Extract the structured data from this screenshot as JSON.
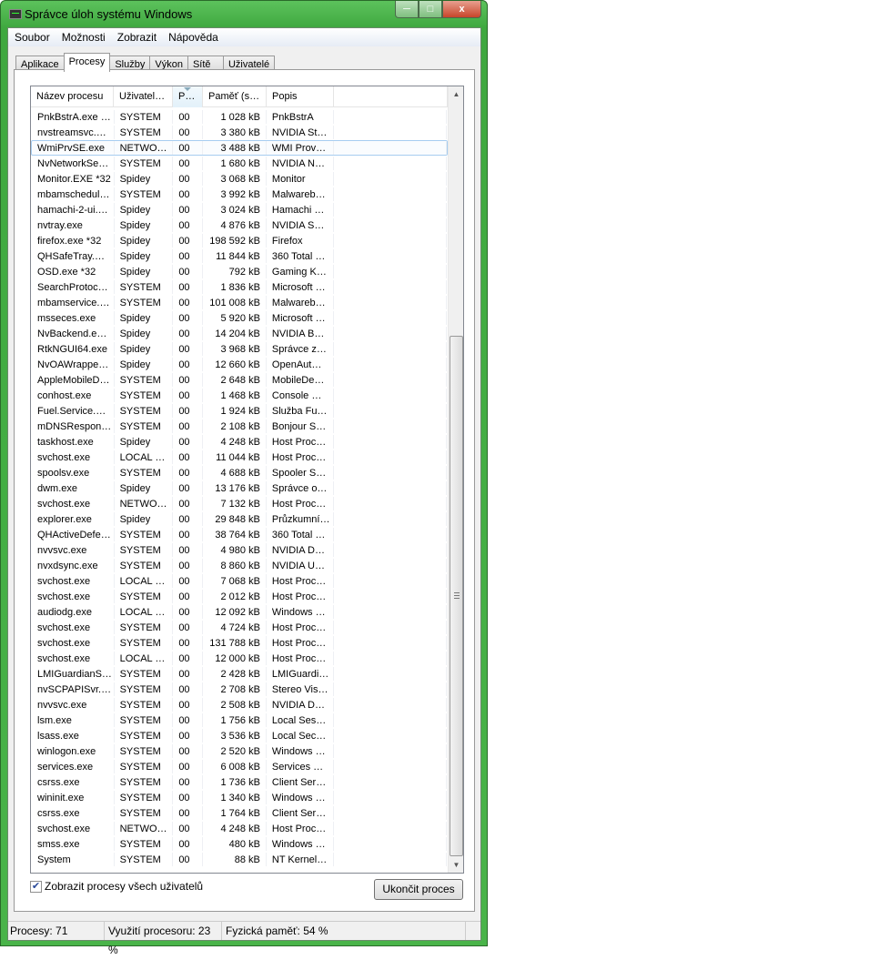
{
  "window": {
    "title": "Správce úloh systému Windows",
    "minimize": "─",
    "maximize": "□",
    "close": "x"
  },
  "menu": [
    {
      "label": "Soubor"
    },
    {
      "label": "Možnosti"
    },
    {
      "label": "Zobrazit"
    },
    {
      "label": "Nápověda"
    }
  ],
  "tabs": [
    {
      "label": "Aplikace"
    },
    {
      "label": "Procesy",
      "active": true
    },
    {
      "label": "Služby"
    },
    {
      "label": "Výkon"
    },
    {
      "label": "Sítě"
    },
    {
      "label": "Uživatelé"
    }
  ],
  "columns": [
    "Název procesu",
    "Uživatel…",
    "P…",
    "Paměť (s…",
    "Popis",
    ""
  ],
  "sorted_column": "P…",
  "selected_row": "WmiPrvSE.exe",
  "rows": [
    [
      "PnkBstrA.exe …",
      "SYSTEM",
      "00",
      "1 028 kB",
      "PnkBstrA"
    ],
    [
      "nvstreamsvc.…",
      "SYSTEM",
      "00",
      "3 380 kB",
      "NVIDIA St…"
    ],
    [
      "WmiPrvSE.exe",
      "NETWO…",
      "00",
      "3 488 kB",
      "WMI Prov…"
    ],
    [
      "NvNetworkSe…",
      "SYSTEM",
      "00",
      "1 680 kB",
      "NVIDIA N…"
    ],
    [
      "Monitor.EXE *32",
      "Spidey",
      "00",
      "3 068 kB",
      "Monitor"
    ],
    [
      "mbamschedul…",
      "SYSTEM",
      "00",
      "3 992 kB",
      "Malwareb…"
    ],
    [
      "hamachi-2-ui.…",
      "Spidey",
      "00",
      "3 024 kB",
      "Hamachi …"
    ],
    [
      "nvtray.exe",
      "Spidey",
      "00",
      "4 876 kB",
      "NVIDIA S…"
    ],
    [
      "firefox.exe *32",
      "Spidey",
      "00",
      "198 592 kB",
      "Firefox"
    ],
    [
      "QHSafeTray.…",
      "Spidey",
      "00",
      "11 844 kB",
      "360 Total …"
    ],
    [
      "OSD.exe *32",
      "Spidey",
      "00",
      "792 kB",
      "Gaming K…"
    ],
    [
      "SearchProtoc…",
      "SYSTEM",
      "00",
      "1 836 kB",
      "Microsoft …"
    ],
    [
      "mbamservice.…",
      "SYSTEM",
      "00",
      "101 008 kB",
      "Malwareb…"
    ],
    [
      "msseces.exe",
      "Spidey",
      "00",
      "5 920 kB",
      "Microsoft …"
    ],
    [
      "NvBackend.e…",
      "Spidey",
      "00",
      "14 204 kB",
      "NVIDIA B…"
    ],
    [
      "RtkNGUI64.exe",
      "Spidey",
      "00",
      "3 968 kB",
      "Správce z…"
    ],
    [
      "NvOAWrappe…",
      "Spidey",
      "00",
      "12 660 kB",
      "OpenAut…"
    ],
    [
      "AppleMobileD…",
      "SYSTEM",
      "00",
      "2 648 kB",
      "MobileDe…"
    ],
    [
      "conhost.exe",
      "SYSTEM",
      "00",
      "1 468 kB",
      "Console …"
    ],
    [
      "Fuel.Service.…",
      "SYSTEM",
      "00",
      "1 924 kB",
      "Služba Fu…"
    ],
    [
      "mDNSRespon…",
      "SYSTEM",
      "00",
      "2 108 kB",
      "Bonjour S…"
    ],
    [
      "taskhost.exe",
      "Spidey",
      "00",
      "4 248 kB",
      "Host Proc…"
    ],
    [
      "svchost.exe",
      "LOCAL …",
      "00",
      "11 044 kB",
      "Host Proc…"
    ],
    [
      "spoolsv.exe",
      "SYSTEM",
      "00",
      "4 688 kB",
      "Spooler S…"
    ],
    [
      "dwm.exe",
      "Spidey",
      "00",
      "13 176 kB",
      "Správce o…"
    ],
    [
      "svchost.exe",
      "NETWO…",
      "00",
      "7 132 kB",
      "Host Proc…"
    ],
    [
      "explorer.exe",
      "Spidey",
      "00",
      "29 848 kB",
      "Průzkumní…"
    ],
    [
      "QHActiveDefe…",
      "SYSTEM",
      "00",
      "38 764 kB",
      "360 Total …"
    ],
    [
      "nvvsvc.exe",
      "SYSTEM",
      "00",
      "4 980 kB",
      "NVIDIA D…"
    ],
    [
      "nvxdsync.exe",
      "SYSTEM",
      "00",
      "8 860 kB",
      "NVIDIA U…"
    ],
    [
      "svchost.exe",
      "LOCAL …",
      "00",
      "7 068 kB",
      "Host Proc…"
    ],
    [
      "svchost.exe",
      "SYSTEM",
      "00",
      "2 012 kB",
      "Host Proc…"
    ],
    [
      "audiodg.exe",
      "LOCAL …",
      "00",
      "12 092 kB",
      "Windows …"
    ],
    [
      "svchost.exe",
      "SYSTEM",
      "00",
      "4 724 kB",
      "Host Proc…"
    ],
    [
      "svchost.exe",
      "SYSTEM",
      "00",
      "131 788 kB",
      "Host Proc…"
    ],
    [
      "svchost.exe",
      "LOCAL …",
      "00",
      "12 000 kB",
      "Host Proc…"
    ],
    [
      "LMIGuardianS…",
      "SYSTEM",
      "00",
      "2 428 kB",
      "LMIGuardi…"
    ],
    [
      "nvSCPAPISvr.…",
      "SYSTEM",
      "00",
      "2 708 kB",
      "Stereo Vis…"
    ],
    [
      "nvvsvc.exe",
      "SYSTEM",
      "00",
      "2 508 kB",
      "NVIDIA D…"
    ],
    [
      "lsm.exe",
      "SYSTEM",
      "00",
      "1 756 kB",
      "Local Ses…"
    ],
    [
      "lsass.exe",
      "SYSTEM",
      "00",
      "3 536 kB",
      "Local Sec…"
    ],
    [
      "winlogon.exe",
      "SYSTEM",
      "00",
      "2 520 kB",
      "Windows …"
    ],
    [
      "services.exe",
      "SYSTEM",
      "00",
      "6 008 kB",
      "Services …"
    ],
    [
      "csrss.exe",
      "SYSTEM",
      "00",
      "1 736 kB",
      "Client Ser…"
    ],
    [
      "wininit.exe",
      "SYSTEM",
      "00",
      "1 340 kB",
      "Windows …"
    ],
    [
      "csrss.exe",
      "SYSTEM",
      "00",
      "1 764 kB",
      "Client Ser…"
    ],
    [
      "svchost.exe",
      "NETWO…",
      "00",
      "4 248 kB",
      "Host Proc…"
    ],
    [
      "smss.exe",
      "SYSTEM",
      "00",
      "480 kB",
      "Windows …"
    ],
    [
      "System",
      "SYSTEM",
      "00",
      "88 kB",
      "NT Kernel…"
    ]
  ],
  "show_all_users": {
    "label": "Zobrazit procesy všech uživatelů",
    "checked": true
  },
  "end_process_button": "Ukončit proces",
  "status": {
    "processes": "Procesy: 71",
    "cpu": "Využití procesoru: 23 %",
    "memory": "Fyzická paměť: 54 %"
  },
  "colors": {
    "frame": "#49b449",
    "selection_border": "#a7cdf0"
  }
}
